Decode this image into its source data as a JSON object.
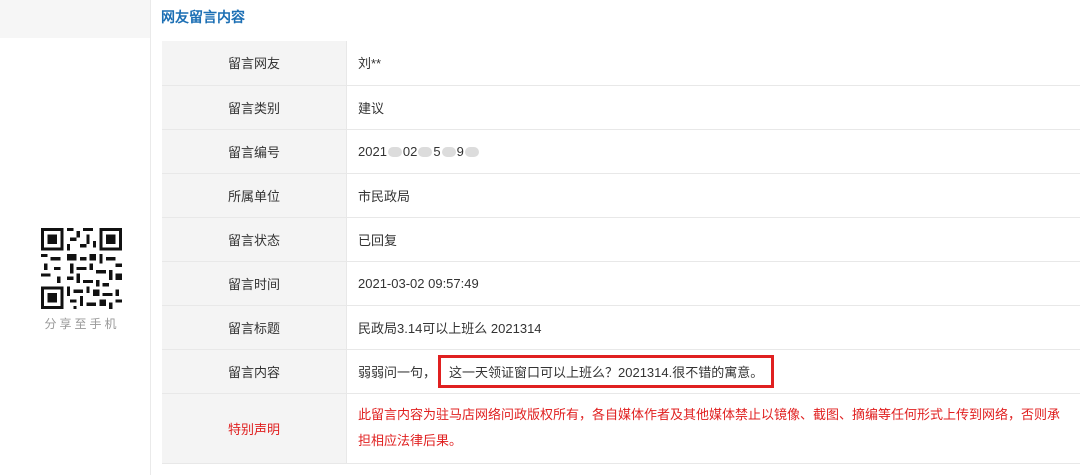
{
  "header": {
    "title": "网友留言内容"
  },
  "sidebar": {
    "share_label": "分享至手机"
  },
  "rows": [
    {
      "label": "留言网友",
      "value": "刘**"
    },
    {
      "label": "留言类别",
      "value": "建议"
    },
    {
      "label": "留言编号",
      "parts": [
        "2021",
        "02",
        "5",
        "9"
      ]
    },
    {
      "label": "所属单位",
      "value": "市民政局"
    },
    {
      "label": "留言状态",
      "value": "已回复"
    },
    {
      "label": "留言时间",
      "value": "2021-03-02 09:57:49"
    },
    {
      "label": "留言标题",
      "value": "民政局3.14可以上班么 2021314"
    },
    {
      "label": "留言内容",
      "prefix": "弱弱问一句，",
      "highlight": "这一天领证窗口可以上班么？2021314.很不错的寓意。"
    },
    {
      "label": "特别声明",
      "value": "此留言内容为驻马店网络问政版权所有，各自媒体作者及其他媒体禁止以镜像、截图、摘编等任何形式上传到网络，否则承担相应法律后果。"
    }
  ],
  "colors": {
    "accent": "#1c6fb4",
    "warning": "#e02020",
    "label_bg": "#f4f4f4"
  },
  "icons": {
    "qr": "qr-code-icon"
  }
}
